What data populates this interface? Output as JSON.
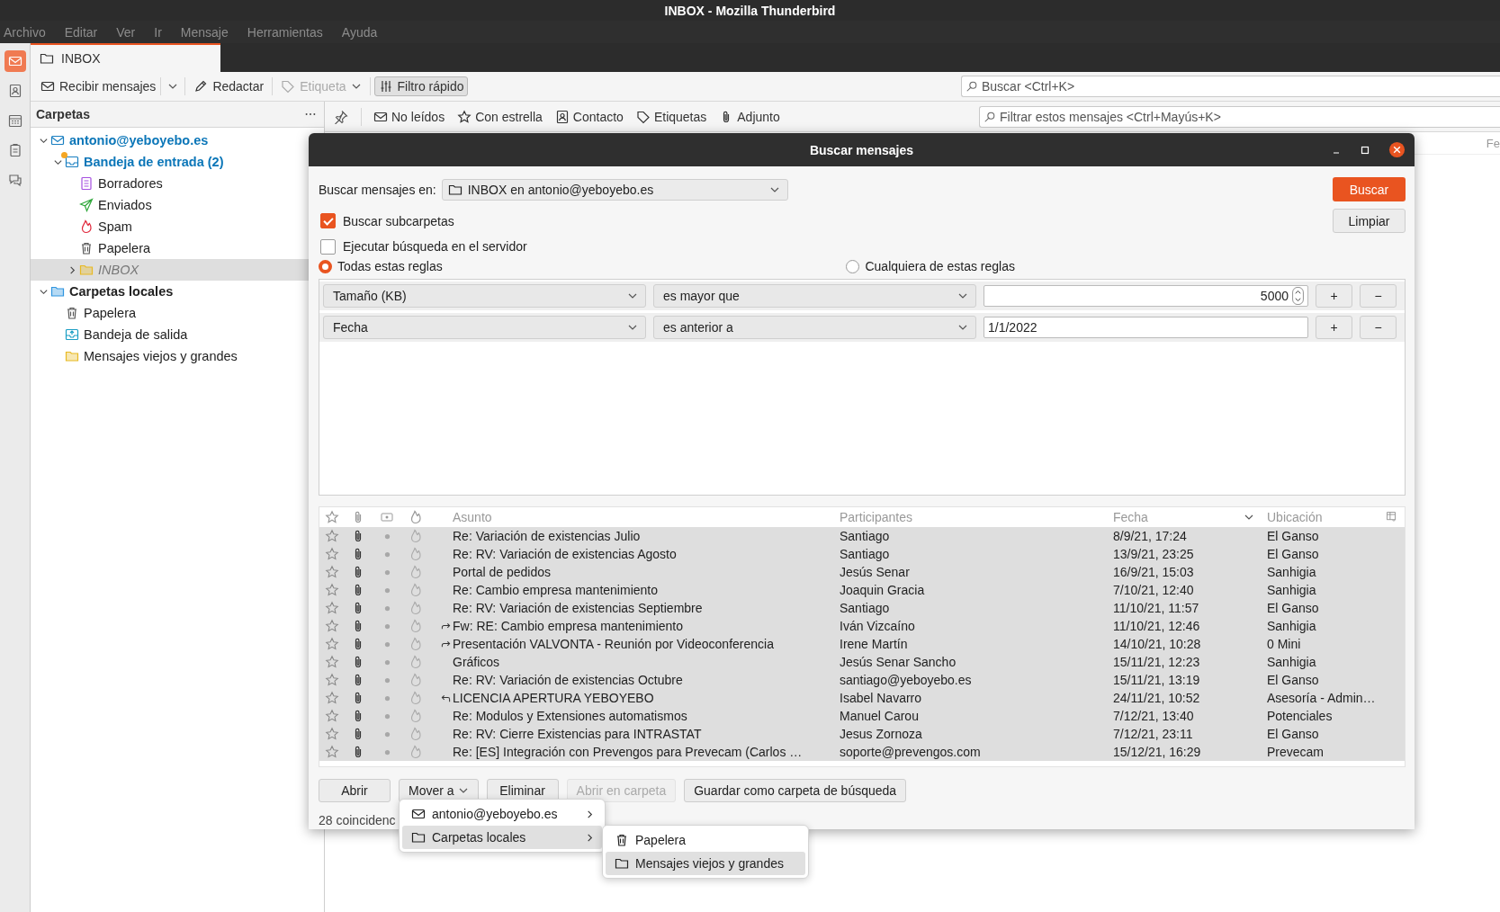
{
  "window": {
    "title": "INBOX - Mozilla Thunderbird"
  },
  "menu_bar": [
    "Archivo",
    "Editar",
    "Ver",
    "Ir",
    "Mensaje",
    "Herramientas",
    "Ayuda"
  ],
  "spaces": [
    {
      "kind": "mail",
      "selected": true
    },
    {
      "kind": "contacts",
      "selected": false
    },
    {
      "kind": "calendar",
      "selected": false
    },
    {
      "kind": "tasks",
      "selected": false
    },
    {
      "kind": "chat",
      "selected": false
    }
  ],
  "tabs": [
    {
      "label": "INBOX",
      "selected": true
    }
  ],
  "toolbar": [
    {
      "kind": "get",
      "label": "Recibir mensajes",
      "disabled": false,
      "pressed": false
    },
    {
      "kind": "write",
      "label": "Redactar",
      "disabled": false,
      "pressed": false
    },
    {
      "kind": "tag",
      "label": "Etiqueta",
      "disabled": true,
      "pressed": false
    },
    {
      "kind": "filter",
      "label": "Filtro rápido",
      "disabled": false,
      "pressed": true
    }
  ],
  "search": {
    "placeholder": "Buscar <Ctrl+K>"
  },
  "folder_pane": {
    "title": "Carpetas",
    "tree": [
      {
        "name": "antonio@yeboyebo.es",
        "kind": "account",
        "expanded": true,
        "new_mail": true,
        "selected": false,
        "subscribed": true,
        "children": [
          {
            "name": "Bandeja de entrada (2)",
            "kind": "inbox",
            "expanded": true,
            "new_mail": true,
            "selected": false,
            "subscribed": true,
            "children": [
              {
                "name": "Borradores",
                "kind": "drafts",
                "new_mail": false,
                "selected": false,
                "subscribed": true
              },
              {
                "name": "Enviados",
                "kind": "sent",
                "new_mail": false,
                "selected": false,
                "subscribed": true
              },
              {
                "name": "Spam",
                "kind": "spam",
                "new_mail": false,
                "selected": false,
                "subscribed": true
              },
              {
                "name": "Papelera",
                "kind": "trash",
                "new_mail": false,
                "selected": false,
                "subscribed": true
              },
              {
                "name": "INBOX",
                "kind": "folder",
                "expanded": false,
                "new_mail": false,
                "selected": true,
                "subscribed": false
              }
            ]
          }
        ]
      },
      {
        "name": "Carpetas locales",
        "kind": "local",
        "expanded": true,
        "new_mail": false,
        "selected": false,
        "subscribed": true,
        "children": [
          {
            "name": "Papelera",
            "kind": "trash",
            "new_mail": false,
            "selected": false,
            "subscribed": true
          },
          {
            "name": "Bandeja de salida",
            "kind": "outbox",
            "new_mail": false,
            "selected": false,
            "subscribed": true
          },
          {
            "name": "Mensajes viejos y grandes",
            "kind": "folder",
            "new_mail": false,
            "selected": false,
            "subscribed": true
          }
        ]
      }
    ]
  },
  "quick_filter": {
    "pinned": false,
    "filters": [
      {
        "kind": "unread",
        "label": "No leídos",
        "selected": false
      },
      {
        "kind": "starred",
        "label": "Con estrella",
        "selected": false
      },
      {
        "kind": "contact",
        "label": "Contacto",
        "selected": false
      },
      {
        "kind": "tags",
        "label": "Etiquetas",
        "selected": false
      },
      {
        "kind": "attachment",
        "label": "Adjunto",
        "selected": false
      }
    ],
    "search": {
      "placeholder": "Filtrar estos mensajes <Ctrl+Mayús+K>"
    }
  },
  "thread_pane": {
    "columns": [
      "Fe"
    ]
  },
  "dialog": {
    "title": "Buscar mensajes",
    "search_in": {
      "label": "Buscar mensajes en:",
      "value": "INBOX en antonio@yeboyebo.es"
    },
    "search_button": "Buscar",
    "clear_button": "Limpiar",
    "options": [
      {
        "label": "Buscar subcarpetas",
        "checked": true
      },
      {
        "label": "Ejecutar búsqueda en el servidor",
        "checked": false
      }
    ],
    "match": [
      {
        "label": "Todas estas reglas",
        "selected": true
      },
      {
        "label": "Cualquiera de estas reglas",
        "selected": false
      }
    ],
    "rules": [
      {
        "field": "Tamaño (KB)",
        "operator": "es mayor que",
        "value": "5000",
        "kind": "number",
        "add": "+",
        "remove": "−"
      },
      {
        "field": "Fecha",
        "operator": "es anterior a",
        "value": "1/1/2022",
        "kind": "text",
        "add": "+",
        "remove": "−"
      }
    ],
    "results": {
      "columns": [
        {
          "label": "Asunto",
          "sorted": false
        },
        {
          "label": "Participantes",
          "sorted": false
        },
        {
          "label": "Fecha",
          "sorted": true
        },
        {
          "label": "Ubicación",
          "sorted": false
        }
      ],
      "rows": [
        {
          "starred": false,
          "attachment": true,
          "forwarded": false,
          "replied": false,
          "subject": "Re: Variación de existencias Julio",
          "participants": "Santiago",
          "date": "8/9/21, 17:24",
          "location": "El Ganso",
          "selected": true
        },
        {
          "starred": false,
          "attachment": true,
          "forwarded": false,
          "replied": false,
          "subject": "Re: RV: Variación de existencias Agosto",
          "participants": "Santiago",
          "date": "13/9/21, 23:25",
          "location": "El Ganso",
          "selected": true
        },
        {
          "starred": false,
          "attachment": true,
          "forwarded": false,
          "replied": false,
          "subject": "Portal de pedidos",
          "participants": "Jesús Senar",
          "date": "16/9/21, 15:03",
          "location": "Sanhigia",
          "selected": true
        },
        {
          "starred": false,
          "attachment": true,
          "forwarded": false,
          "replied": false,
          "subject": "Re: Cambio empresa mantenimiento",
          "participants": "Joaquin Gracia",
          "date": "7/10/21, 12:40",
          "location": "Sanhigia",
          "selected": true
        },
        {
          "starred": false,
          "attachment": true,
          "forwarded": false,
          "replied": false,
          "subject": "Re: RV: Variación de existencias Septiembre",
          "participants": "Santiago",
          "date": "11/10/21, 11:57",
          "location": "El Ganso",
          "selected": true
        },
        {
          "starred": false,
          "attachment": true,
          "forwarded": true,
          "replied": false,
          "subject": "Fw: RE: Cambio empresa mantenimiento",
          "participants": "Iván Vizcaíno",
          "date": "11/10/21, 12:46",
          "location": "Sanhigia",
          "selected": true
        },
        {
          "starred": false,
          "attachment": true,
          "forwarded": true,
          "replied": false,
          "subject": "Presentación VALVONTA - Reunión por Videoconferencia",
          "participants": "Irene Martín",
          "date": "14/10/21, 10:28",
          "location": "0 Mini",
          "selected": true
        },
        {
          "starred": false,
          "attachment": true,
          "forwarded": false,
          "replied": false,
          "subject": "Gráficos",
          "participants": "Jesús Senar Sancho",
          "date": "15/11/21, 12:23",
          "location": "Sanhigia",
          "selected": true
        },
        {
          "starred": false,
          "attachment": true,
          "forwarded": false,
          "replied": false,
          "subject": "Re: RV: Variación de existencias Octubre",
          "participants": "santiago@yeboyebo.es",
          "date": "15/11/21, 13:19",
          "location": "El Ganso",
          "selected": true
        },
        {
          "starred": false,
          "attachment": true,
          "forwarded": false,
          "replied": true,
          "subject": "LICENCIA APERTURA YEBOYEBO",
          "participants": "Isabel Navarro",
          "date": "24/11/21, 10:52",
          "location": "Asesoría - Admin…",
          "selected": true
        },
        {
          "starred": false,
          "attachment": true,
          "forwarded": false,
          "replied": false,
          "subject": "Re: Modulos y Extensiones automatismos",
          "participants": "Manuel Carou",
          "date": "7/12/21, 13:40",
          "location": "Potenciales",
          "selected": true
        },
        {
          "starred": false,
          "attachment": true,
          "forwarded": false,
          "replied": false,
          "subject": "Re: RV: Cierre Existencias para INTRASTAT",
          "participants": "Jesus Zornoza",
          "date": "7/12/21, 23:11",
          "location": "El Ganso",
          "selected": true
        },
        {
          "starred": false,
          "attachment": true,
          "forwarded": false,
          "replied": false,
          "subject": "Re: [ES] Integración con Prevengos para Prevecam (Carlos …",
          "participants": "soporte@prevengos.com",
          "date": "15/12/21, 16:29",
          "location": "Prevecam",
          "selected": true
        }
      ]
    },
    "buttons": [
      {
        "label": "Abrir",
        "kind": "plain",
        "disabled": false
      },
      {
        "label": "Mover a",
        "kind": "menu",
        "disabled": false
      },
      {
        "label": "Eliminar",
        "kind": "plain",
        "disabled": false
      },
      {
        "label": "Abrir en carpeta",
        "kind": "plain",
        "disabled": true
      },
      {
        "label": "Guardar como carpeta de búsqueda",
        "kind": "plain",
        "disabled": false
      }
    ],
    "status": "28 coincidenc"
  },
  "move_menu": {
    "items": [
      {
        "label": "antonio@yeboyebo.es",
        "kind": "account",
        "selected": false
      },
      {
        "label": "Carpetas locales",
        "kind": "folder",
        "selected": true
      }
    ],
    "submenu": [
      {
        "label": "Papelera",
        "kind": "trash",
        "selected": false
      },
      {
        "label": "Mensajes viejos y grandes",
        "kind": "folder",
        "selected": true
      }
    ]
  }
}
